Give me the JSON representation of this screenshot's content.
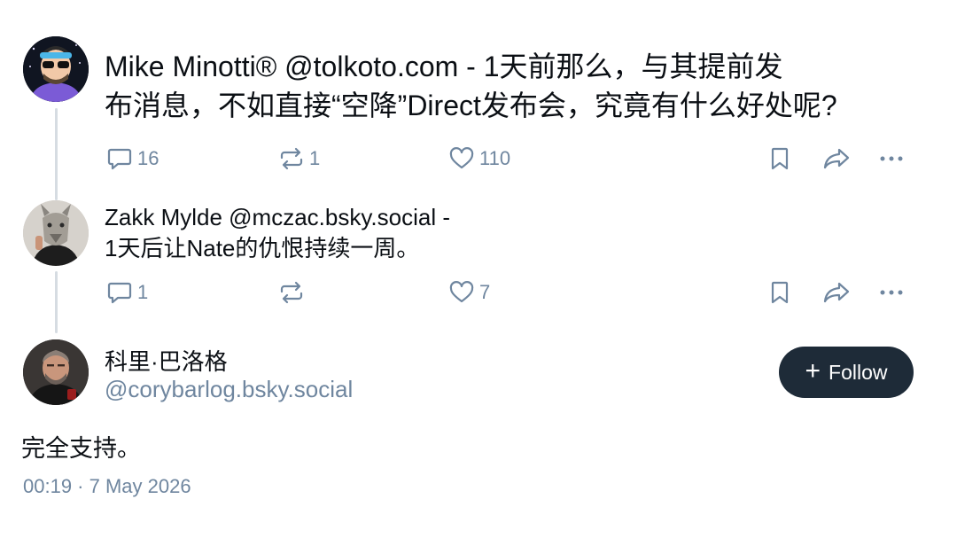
{
  "thread": [
    {
      "author": "Mike Minotti®",
      "handle": "@tolkoto.com",
      "time": "1天前",
      "separator": " - ",
      "line1_text": "那么，与其提前发",
      "line2_text": "布消息，不如直接“空降”Direct发布会，究竟有什么好处呢?",
      "replies": "16",
      "reposts": "1",
      "likes": "110"
    },
    {
      "author": "Zakk Mylde",
      "handle": "@mczac.bsky.social",
      "separator": " -",
      "time": "1天后",
      "line2_text": "让Nate的仇恨持续一周。",
      "replies": "1",
      "reposts": "",
      "likes": "7"
    }
  ],
  "main_post": {
    "author": "科里·巴洛格",
    "handle": "@corybarlog.bsky.social",
    "follow_plus": "+",
    "follow_label": "Follow",
    "text": "完全支持。",
    "timestamp": "00:19 · 7 May 2026"
  },
  "icons": [
    "reply-icon",
    "repost-icon",
    "like-icon",
    "bookmark-icon",
    "share-icon",
    "more-icon"
  ],
  "colors": {
    "text": "#0b0f14",
    "muted": "#6f869f",
    "thread_line": "#d6dce2",
    "follow_bg": "#1e2b38",
    "follow_text": "#ffffff"
  }
}
